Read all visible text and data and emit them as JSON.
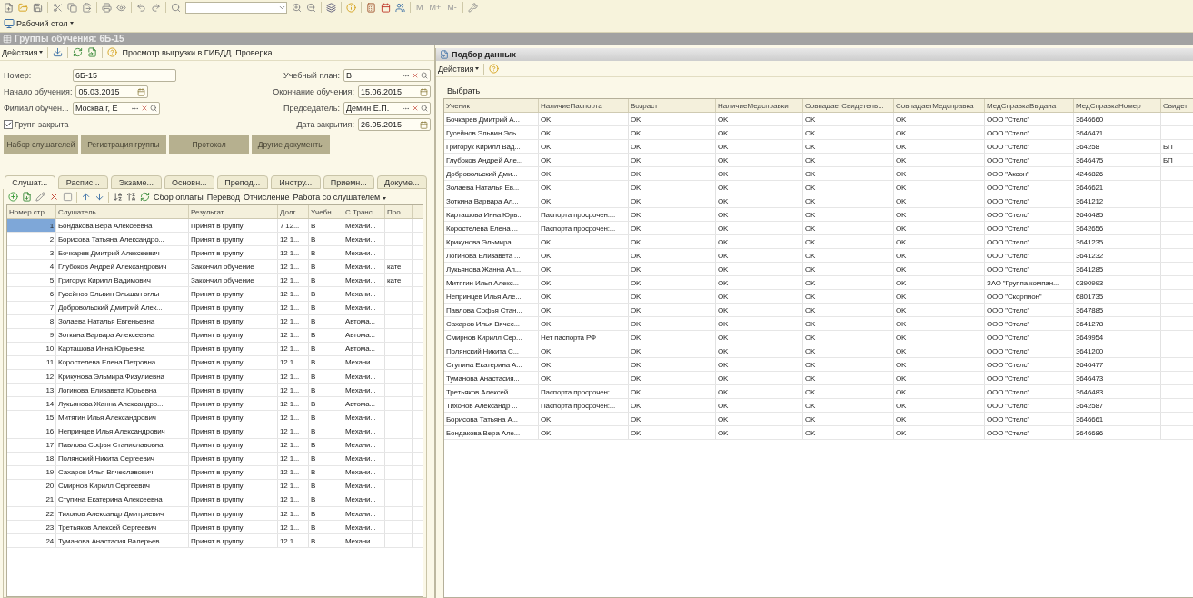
{
  "toolbar": {
    "memory_buttons": [
      "M",
      "M+",
      "M-"
    ]
  },
  "desktop_button": {
    "label": "Рабочий стол"
  },
  "left_window": {
    "title": "Группы обучения: 6Б-15",
    "actions_label": "Действия",
    "links": [
      "Просмотр выгрузки в ГИБДД",
      "Проверка"
    ],
    "form_rows": [
      {
        "left": {
          "kind": "text",
          "label": "Номер:",
          "value": "6Б-15"
        },
        "right": {
          "kind": "ref",
          "label": "Учебный план:",
          "value": "В"
        }
      },
      {
        "left": {
          "kind": "date",
          "label": "Начало обучения:",
          "value": "05.03.2015"
        },
        "right": {
          "kind": "date",
          "label": "Окончание обучения:",
          "value": "15.06.2015"
        }
      },
      {
        "left": {
          "kind": "ref",
          "label": "Филиал обучен...",
          "value": "Москва г, Е"
        },
        "right": {
          "kind": "ref",
          "label": "Председатель:",
          "value": "Демин Е.П."
        }
      },
      {
        "left": {
          "kind": "checkbox",
          "label": "Групп закрыта",
          "checked": true
        },
        "right": {
          "kind": "date",
          "label": "Дата закрытия:",
          "value": "26.05.2015"
        }
      }
    ],
    "buttons": [
      "Набор слушателей",
      "Регистрация группы",
      "Протокол",
      "Другие документы"
    ],
    "tabs": [
      {
        "label": "Слушат...",
        "selected": true
      },
      {
        "label": "Распис...",
        "selected": false
      },
      {
        "label": "Экзаме...",
        "selected": false
      },
      {
        "label": "Основн...",
        "selected": false
      },
      {
        "label": "Препод...",
        "selected": false
      },
      {
        "label": "Инстру...",
        "selected": false
      },
      {
        "label": "Приемн...",
        "selected": false
      },
      {
        "label": "Докуме...",
        "selected": false
      }
    ],
    "table_links": [
      {
        "label": "Сбор оплаты",
        "dropdown": false
      },
      {
        "label": "Перевод",
        "dropdown": false
      },
      {
        "label": "Отчисление",
        "dropdown": false
      },
      {
        "label": "Работа со слушателем",
        "dropdown": true
      }
    ],
    "table": {
      "columns": [
        "Номер стр...",
        "Слушатель",
        "Результат",
        "Долг",
        "Учебн...",
        "С Транс...",
        "Про"
      ],
      "rows": [
        {
          "cells": [
            "1",
            "Бондакова Вера Алексеевна",
            "Принят в группу",
            "7 12...",
            "В",
            "Механи..."
          ],
          "selected": true
        },
        {
          "cells": [
            "2",
            "Борисова Татьяна Александро...",
            "Принят в группу",
            "12 1...",
            "В",
            "Механи..."
          ],
          "selected": false
        },
        {
          "cells": [
            "3",
            "Бочкарев Дмитрий Алексеевич",
            "Принят в группу",
            "12 1...",
            "В",
            "Механи..."
          ],
          "selected": false
        },
        {
          "cells": [
            "4",
            "Глубоков Андрей Александрович",
            "Закончил обучение",
            "12 1...",
            "В",
            "Механи..."
          ],
          "column_7": "кате",
          "selected": false
        },
        {
          "cells": [
            "5",
            "Григорук Кирилл Вадимович",
            "Закончил обучение",
            "12 1...",
            "В",
            "Механи..."
          ],
          "column_7": "кате",
          "selected": false
        },
        {
          "cells": [
            "6",
            "Гусейнов Эльвин Эльшан оглы",
            "Принят в группу",
            "12 1...",
            "В",
            "Механи..."
          ],
          "selected": false
        },
        {
          "cells": [
            "7",
            "Добровольский Дмитрий Алек...",
            "Принят в группу",
            "12 1...",
            "В",
            "Механи..."
          ],
          "selected": false
        },
        {
          "cells": [
            "8",
            "Золаева Наталья Евгеньевна",
            "Принят в группу",
            "12 1...",
            "В",
            "Автома..."
          ],
          "selected": false
        },
        {
          "cells": [
            "9",
            "Зоткина Варвара Алексеевна",
            "Принят в группу",
            "12 1...",
            "В",
            "Автома..."
          ],
          "selected": false
        },
        {
          "cells": [
            "10",
            "Карташова Инна Юрьевна",
            "Принят в группу",
            "12 1...",
            "В",
            "Автома..."
          ],
          "selected": false
        },
        {
          "cells": [
            "11",
            "Коростелева Елена Петровна",
            "Принят в группу",
            "12 1...",
            "В",
            "Механи..."
          ],
          "selected": false
        },
        {
          "cells": [
            "12",
            "Крикунова Эльмира Физулиевна",
            "Принят в группу",
            "12 1...",
            "В",
            "Механи..."
          ],
          "selected": false
        },
        {
          "cells": [
            "13",
            "Логинова Елизавета Юрьевна",
            "Принят в группу",
            "12 1...",
            "В",
            "Механи..."
          ],
          "selected": false
        },
        {
          "cells": [
            "14",
            "Лукьянова Жанна Александро...",
            "Принят в группу",
            "12 1...",
            "В",
            "Автома..."
          ],
          "selected": false
        },
        {
          "cells": [
            "15",
            "Митягин Илья Александрович",
            "Принят в группу",
            "12 1...",
            "В",
            "Механи..."
          ],
          "selected": false
        },
        {
          "cells": [
            "16",
            "Непринцев Илья Александрович",
            "Принят в группу",
            "12 1...",
            "В",
            "Механи..."
          ],
          "selected": false
        },
        {
          "cells": [
            "17",
            "Павлова Софья Станиславовна",
            "Принят в группу",
            "12 1...",
            "В",
            "Механи..."
          ],
          "selected": false
        },
        {
          "cells": [
            "18",
            "Полянский Никита Сергеевич",
            "Принят в группу",
            "12 1...",
            "В",
            "Механи..."
          ],
          "selected": false
        },
        {
          "cells": [
            "19",
            "Сахаров Илья Вячеславович",
            "Принят в группу",
            "12 1...",
            "В",
            "Механи..."
          ],
          "selected": false
        },
        {
          "cells": [
            "20",
            "Смирнов Кирилл Сергеевич",
            "Принят в группу",
            "12 1...",
            "В",
            "Механи..."
          ],
          "selected": false
        },
        {
          "cells": [
            "21",
            "Ступина Екатерина Алексеевна",
            "Принят в группу",
            "12 1...",
            "В",
            "Механи..."
          ],
          "selected": false
        },
        {
          "cells": [
            "22",
            "Тихонов Александр Дмитриевич",
            "Принят в группу",
            "12 1...",
            "В",
            "Механи..."
          ],
          "selected": false
        },
        {
          "cells": [
            "23",
            "Третьяков Алексей Сергеевич",
            "Принят в группу",
            "12 1...",
            "В",
            "Механи..."
          ],
          "selected": false
        },
        {
          "cells": [
            "24",
            "Туманова Анастасия Валерьев...",
            "Принят в группу",
            "12 1...",
            "В",
            "Механи..."
          ],
          "selected": false
        }
      ]
    }
  },
  "right_window": {
    "title": "Подбор данных",
    "actions_label": "Действия",
    "select_label": "Выбрать",
    "table": {
      "columns": [
        "Ученик",
        "НаличиеПаспорта",
        "Возраст",
        "НаличиеМедсправки",
        "СовпадаетСвидетель...",
        "СовпадаетМедсправка",
        "МедСправкаВыдана",
        "МедСправкаНомер",
        "Свидет"
      ],
      "rows": [
        {
          "cells": [
            "Бочкарев Дмитрий А...",
            "OK",
            "OK",
            "OK",
            "OK",
            "OK",
            "ООО \"Стелс\"",
            "3646660"
          ]
        },
        {
          "cells": [
            "Гусейнов Эльвин Эль...",
            "OK",
            "OK",
            "OK",
            "OK",
            "OK",
            "ООО \"Стелс\"",
            "3646471"
          ]
        },
        {
          "cells": [
            "Григорук Кирилл Вад...",
            "OK",
            "OK",
            "OK",
            "OK",
            "OK",
            "ООО \"Стелс\"",
            "364258"
          ],
          "column_9": "БП"
        },
        {
          "cells": [
            "Глубоков Андрей Але...",
            "OK",
            "OK",
            "OK",
            "OK",
            "OK",
            "ООО \"Стелс\"",
            "3646475"
          ],
          "column_9": "БП"
        },
        {
          "cells": [
            "Добровольский Дми...",
            "OK",
            "OK",
            "OK",
            "OK",
            "OK",
            "ООО \"Аксон\"",
            "4246826"
          ]
        },
        {
          "cells": [
            "Золаева Наталья Ев...",
            "OK",
            "OK",
            "OK",
            "OK",
            "OK",
            "ООО \"Стелс\"",
            "3646621"
          ]
        },
        {
          "cells": [
            "Зоткина Варвара Ал...",
            "OK",
            "OK",
            "OK",
            "OK",
            "OK",
            "ООО \"Стелс\"",
            "3641212"
          ]
        },
        {
          "cells": [
            "Карташова Инна Юрь...",
            "Паспорта просрочен:...",
            "OK",
            "OK",
            "OK",
            "OK",
            "ООО \"Стелс\"",
            "3646485"
          ]
        },
        {
          "cells": [
            "Коростелева Елена ...",
            "Паспорта просрочен:...",
            "OK",
            "OK",
            "OK",
            "OK",
            "ООО \"Стелс\"",
            "3642656"
          ]
        },
        {
          "cells": [
            "Крикунова Эльмира ...",
            "OK",
            "OK",
            "OK",
            "OK",
            "OK",
            "ООО \"Стелс\"",
            "3641235"
          ]
        },
        {
          "cells": [
            "Логинова Елизавета ...",
            "OK",
            "OK",
            "OK",
            "OK",
            "OK",
            "ООО \"Стелс\"",
            "3641232"
          ]
        },
        {
          "cells": [
            "Лукьянова Жанна Ал...",
            "OK",
            "OK",
            "OK",
            "OK",
            "OK",
            "ООО \"Стелс\"",
            "3641285"
          ]
        },
        {
          "cells": [
            "Митягин Илья Алекс...",
            "OK",
            "OK",
            "OK",
            "OK",
            "OK",
            "ЗАО \"Группа компан...",
            "0390993"
          ]
        },
        {
          "cells": [
            "Непринцев Илья Але...",
            "OK",
            "OK",
            "OK",
            "OK",
            "OK",
            "ООО \"Скорпион\"",
            "6801735"
          ]
        },
        {
          "cells": [
            "Павлова Софья Стан...",
            "OK",
            "OK",
            "OK",
            "OK",
            "OK",
            "ООО \"Стелс\"",
            "3647885"
          ]
        },
        {
          "cells": [
            "Сахаров Илья Вячес...",
            "OK",
            "OK",
            "OK",
            "OK",
            "OK",
            "ООО \"Стелс\"",
            "3641278"
          ]
        },
        {
          "cells": [
            "Смирнов Кирилл Сер...",
            "Нет паспорта РФ",
            "OK",
            "OK",
            "OK",
            "OK",
            "ООО \"Стелс\"",
            "3649954"
          ]
        },
        {
          "cells": [
            "Полянский Никита С...",
            "OK",
            "OK",
            "OK",
            "OK",
            "OK",
            "ООО \"Стелс\"",
            "3641200"
          ]
        },
        {
          "cells": [
            "Ступина Екатерина А...",
            "OK",
            "OK",
            "OK",
            "OK",
            "OK",
            "ООО \"Стелс\"",
            "3646477"
          ]
        },
        {
          "cells": [
            "Туманова Анастасия...",
            "OK",
            "OK",
            "OK",
            "OK",
            "OK",
            "ООО \"Стелс\"",
            "3646473"
          ]
        },
        {
          "cells": [
            "Третьяков Алексей ...",
            "Паспорта просрочен:...",
            "OK",
            "OK",
            "OK",
            "OK",
            "ООО \"Стелс\"",
            "3646483"
          ]
        },
        {
          "cells": [
            "Тихонов Александр ...",
            "Паспорта просрочен:...",
            "OK",
            "OK",
            "OK",
            "OK",
            "ООО \"Стелс\"",
            "3642587"
          ]
        },
        {
          "cells": [
            "Борисова Татьяна А...",
            "OK",
            "OK",
            "OK",
            "OK",
            "OK",
            "ООО \"Стелс\"",
            "3646661"
          ]
        },
        {
          "cells": [
            "Бондакова Вера Але...",
            "OK",
            "OK",
            "OK",
            "OK",
            "OK",
            "ООО \"Стелс\"",
            "3646686"
          ]
        }
      ]
    }
  }
}
